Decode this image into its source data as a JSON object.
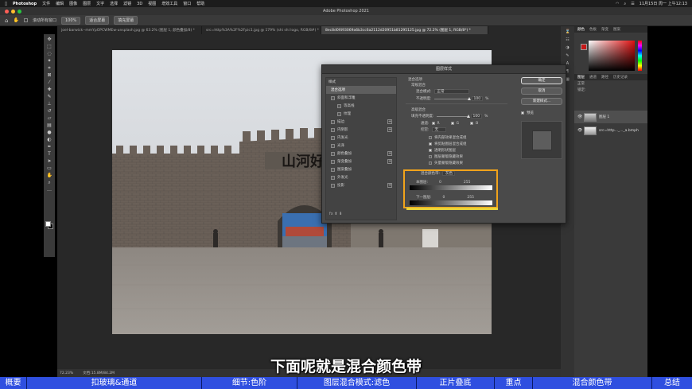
{
  "menubar": {
    "app": "Photoshop",
    "items": [
      "文件",
      "编辑",
      "图像",
      "图层",
      "文字",
      "选择",
      "滤镜",
      "3D",
      "视图",
      "增效工具",
      "窗口",
      "帮助"
    ],
    "datetime": "11月15日 周一 上午12:13"
  },
  "window": {
    "title": "Adobe Photoshop 2021"
  },
  "options": {
    "checkbox_label": "滚动所有窗口",
    "zoom": "100%",
    "fit_screen": "适合屏幕",
    "fill_screen": "填充屏幕"
  },
  "tabs": [
    "joel-barwick--mmYpOPCWMEw-unsplash.jpg @ 63.2% (图层 1, 颜色叠加/8) *",
    "src=http%3A%2F%2Fpic1.jpg @ 179% (shi shi logo, RGB/8#) *",
    "8ec8d0f493069a6b3cc6a2112d20951b81295125.jpg @ 72.2% (图层 1, RGB/8*) *"
  ],
  "status": {
    "zoom": "72.23%",
    "doc": "文档:15.8M/84.2M"
  },
  "panels": {
    "tabs_top": [
      "颜色",
      "色板",
      "渐变",
      "图案"
    ],
    "tabs_layers": [
      "图层",
      "通道",
      "路径",
      "历史记录"
    ],
    "layers": [
      {
        "name": "图层 1"
      },
      {
        "name": "src=http..._..._a.bmph"
      }
    ],
    "kind_label": "正常",
    "lock_label": "锁定:"
  },
  "dialog": {
    "title": "图层样式",
    "styles_header": "样式",
    "style_items": [
      {
        "label": "混合选项",
        "checkbox": false,
        "plus": false,
        "sub": false,
        "selected": true
      },
      {
        "label": "斜面和浮雕",
        "checkbox": true,
        "plus": false,
        "sub": false,
        "selected": false
      },
      {
        "label": "等高线",
        "checkbox": true,
        "plus": false,
        "sub": true,
        "selected": false
      },
      {
        "label": "纹理",
        "checkbox": true,
        "plus": false,
        "sub": true,
        "selected": false
      },
      {
        "label": "描边",
        "checkbox": true,
        "plus": true,
        "sub": false,
        "selected": false
      },
      {
        "label": "内阴影",
        "checkbox": true,
        "plus": true,
        "sub": false,
        "selected": false
      },
      {
        "label": "内发光",
        "checkbox": true,
        "plus": false,
        "sub": false,
        "selected": false
      },
      {
        "label": "光泽",
        "checkbox": true,
        "plus": false,
        "sub": false,
        "selected": false
      },
      {
        "label": "颜色叠加",
        "checkbox": true,
        "plus": true,
        "sub": false,
        "selected": false
      },
      {
        "label": "渐变叠加",
        "checkbox": true,
        "plus": true,
        "sub": false,
        "selected": false
      },
      {
        "label": "图案叠加",
        "checkbox": true,
        "plus": false,
        "sub": false,
        "selected": false
      },
      {
        "label": "外发光",
        "checkbox": true,
        "plus": false,
        "sub": false,
        "selected": false
      },
      {
        "label": "投影",
        "checkbox": true,
        "plus": true,
        "sub": false,
        "selected": false
      }
    ],
    "footer_icons": "fx  ⬆  ⬇",
    "blend": {
      "section_title": "混合选项",
      "general_title": "常规混合",
      "mode_label": "混合模式:",
      "mode_value": "正常",
      "opacity_label": "不透明度:",
      "opacity_value": "100",
      "percent": "%",
      "advanced_title": "高级混合",
      "fill_label": "填充不透明度:",
      "fill_value": "100",
      "channels_label": "通道:",
      "channels": [
        "R",
        "G",
        "B"
      ],
      "knockout_label": "挖空:",
      "knockout_value": "无",
      "options": [
        {
          "label": "将内部效果混合成组",
          "checked": false
        },
        {
          "label": "将剪贴图层混合成组",
          "checked": true
        },
        {
          "label": "透明形状图层",
          "checked": true
        },
        {
          "label": "图层蒙版隐藏效果",
          "checked": false
        },
        {
          "label": "矢量蒙版隐藏效果",
          "checked": false
        }
      ],
      "blendif_label": "混合颜色带:",
      "blendif_value": "灰色",
      "this_layer_label": "本图层:",
      "this_layer_min": "0",
      "this_layer_max": "255",
      "under_layer_label": "下一图层:",
      "under_layer_min": "0",
      "under_layer_max": "255"
    },
    "buttons": {
      "ok": "确定",
      "cancel": "取消",
      "new_style": "新建样式...",
      "preview": "预览"
    }
  },
  "subtitle": "下面呢就是混合颜色带",
  "chapters": [
    "概要",
    "扣玻璃&通道",
    "细节:色阶",
    "图层混合模式:滤色",
    "正片叠底",
    "重点",
    "混合颜色带",
    "总结"
  ],
  "colors": {
    "chapter_bar": "#2f4fe0",
    "highlight": "#f1a31b",
    "color_swatch": "#c41818"
  },
  "canvas_text": "山河好"
}
